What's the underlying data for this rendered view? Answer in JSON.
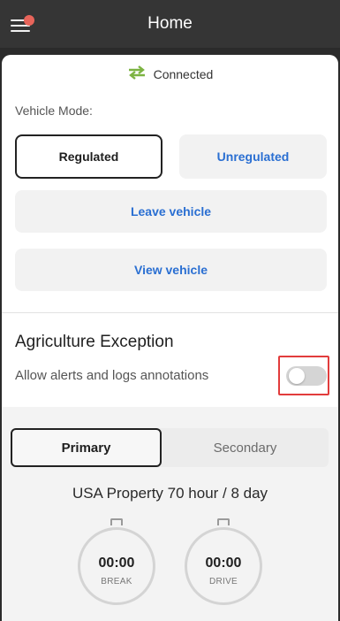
{
  "app": {
    "title": "Home",
    "menu_icon": "hamburger-menu-icon",
    "notification_color": "#e7645a"
  },
  "connection": {
    "status": "Connected",
    "icon": "swap-arrows-icon",
    "color": "#7cb342"
  },
  "vehicle_mode": {
    "label": "Vehicle Mode:",
    "regulated_label": "Regulated",
    "unregulated_label": "Unregulated",
    "selected": "Regulated",
    "leave_label": "Leave vehicle",
    "view_label": "View vehicle",
    "accent_color": "#2a6fd2"
  },
  "agriculture": {
    "title": "Agriculture Exception",
    "subtitle": "Allow alerts and logs annotations",
    "toggle_on": false
  },
  "ruleset": {
    "tabs": [
      "Primary",
      "Secondary"
    ],
    "selected_tab": "Primary",
    "name": "USA Property 70 hour / 8 day"
  },
  "timers": [
    {
      "time": "00:00",
      "label": "BREAK"
    },
    {
      "time": "00:00",
      "label": "DRIVE"
    }
  ]
}
